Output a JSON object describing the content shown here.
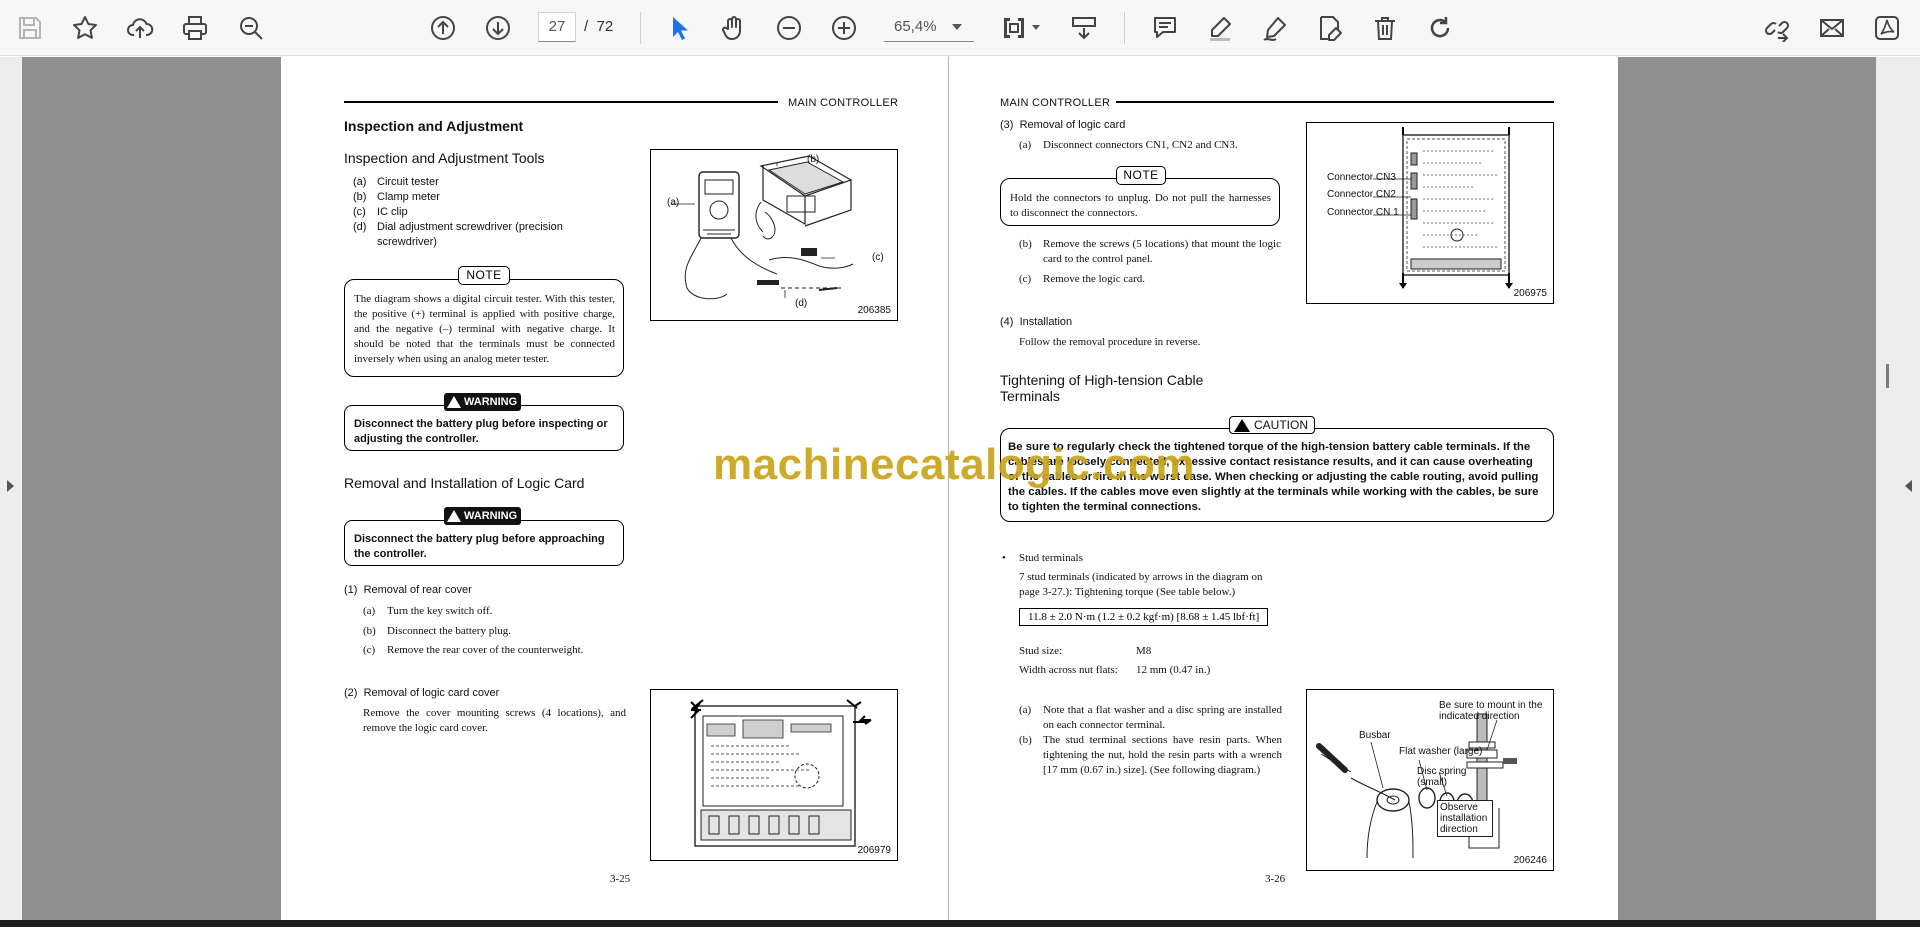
{
  "toolbar": {
    "current_page": "27",
    "page_separator": "/",
    "page_total": "72",
    "zoom": "65,4%"
  },
  "left_page": {
    "header": "MAIN CONTROLLER",
    "title": "Inspection and Adjustment",
    "tools_heading": "Inspection and Adjustment Tools",
    "tools": [
      {
        "label": "(a)",
        "text": "Circuit tester"
      },
      {
        "label": "(b)",
        "text": "Clamp meter"
      },
      {
        "label": "(c)",
        "text": "IC clip"
      },
      {
        "label": "(d)",
        "text": "Dial adjustment screwdriver (precision screwdriver)"
      }
    ],
    "note_label": "NOTE",
    "note_text": "The diagram shows a digital circuit tester.  With this tester, the positive (+) terminal is applied with positive charge, and the negative (–) terminal with negative charge.  It should be noted that the terminals must be connected inversely when using an analog meter tester.",
    "warning1_label": "WARNING",
    "warning1_text": "Disconnect the battery plug before inspecting or adjusting the controller.",
    "removal_heading": "Removal and Installation of Logic Card",
    "warning2_label": "WARNING",
    "warning2_text": "Disconnect the battery plug before approaching the controller.",
    "step1_num": "(1)",
    "step1_title": "Removal of rear cover",
    "step1_items": [
      {
        "label": "(a)",
        "text": "Turn the key switch off."
      },
      {
        "label": "(b)",
        "text": "Disconnect the battery plug."
      },
      {
        "label": "(c)",
        "text": "Remove the rear cover of the counterweight."
      }
    ],
    "step2_num": "(2)",
    "step2_title": "Removal of logic card cover",
    "step2_text": "Remove the cover mounting screws (4 locations), and remove the logic card cover.",
    "fig1": {
      "id": "206385",
      "labels": [
        "(a)",
        "(b)",
        "(c)",
        "(d)"
      ]
    },
    "fig2": {
      "id": "206979"
    },
    "page_number": "3-25"
  },
  "right_page": {
    "header": "MAIN CONTROLLER",
    "step3_num": "(3)",
    "step3_title": "Removal of logic card",
    "step3_items": [
      {
        "label": "(a)",
        "text": "Disconnect connectors CN1, CN2 and CN3."
      },
      {
        "label": "(b)",
        "text": "Remove the screws (5 locations) that mount the logic card to the control panel."
      },
      {
        "label": "(c)",
        "text": "Remove the logic card."
      }
    ],
    "note_label": "NOTE",
    "note_text": "Hold the connectors to unplug.  Do not pull the harnesses to disconnect the connectors.",
    "step4_num": "(4)",
    "step4_title": "Installation",
    "step4_text": "Follow the removal procedure in reverse.",
    "tighten_heading_1": "Tightening of High-tension Cable",
    "tighten_heading_2": "Terminals",
    "caution_label": "CAUTION",
    "caution_text": "Be sure to regularly check the tightened torque of the high-tension battery cable terminals.  If the cables are loosely connected, excessive contact resistance results, and it can cause overheating of the cables or fire in the worst case.  When checking or adjusting the cable routing, avoid pulling the cables.  If the cables move even slightly at the terminals while working with the cables, be sure to tighten the terminal connections.",
    "bullet": "•",
    "stud_title": "Stud terminals",
    "stud_text": "7 stud terminals (indicated by arrows in the diagram on page 3-27.):  Tightening torque (See table below.)",
    "torque": "11.8 ± 2.0 N·m (1.2 ± 0.2 kgf·m) [8.68 ± 1.45 lbf·ft]",
    "stud_size_label": "Stud size:",
    "stud_size_value": "M8",
    "width_label": "Width across nut flats:",
    "width_value": "12 mm (0.47 in.)",
    "notes": [
      {
        "label": "(a)",
        "text": "Note that a flat washer and a disc spring are installed on each connector terminal."
      },
      {
        "label": "(b)",
        "text": "The stud terminal sections have resin parts.  When tightening the nut, hold the resin parts with a wrench [17 mm (0.67 in.) size].  (See following diagram.)"
      }
    ],
    "fig3": {
      "id": "206975",
      "labels": [
        "Connector CN3",
        "Connector CN2",
        "Connector CN 1"
      ]
    },
    "fig4": {
      "id": "206246",
      "labels": [
        "Be sure to mount in the indicated direction",
        "Busbar",
        "Flat washer (large)",
        "Disc spring (small)",
        "Observe installation direction"
      ]
    },
    "page_number": "3-26"
  },
  "watermark": "machinecatalogic.com"
}
